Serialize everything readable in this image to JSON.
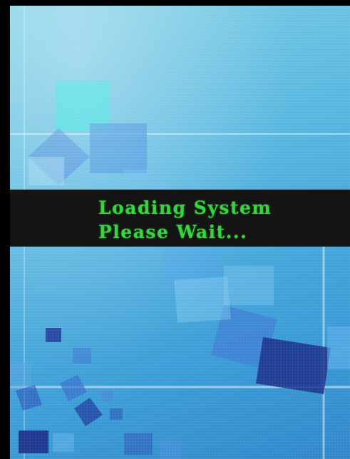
{
  "screen": {
    "state": "boot",
    "loading_line_1": "Loading System",
    "loading_line_2": "Please Wait..."
  },
  "colors": {
    "banner_background": "#141414",
    "loading_text": "#35d63d",
    "wallpaper_base": "#55b5df"
  }
}
